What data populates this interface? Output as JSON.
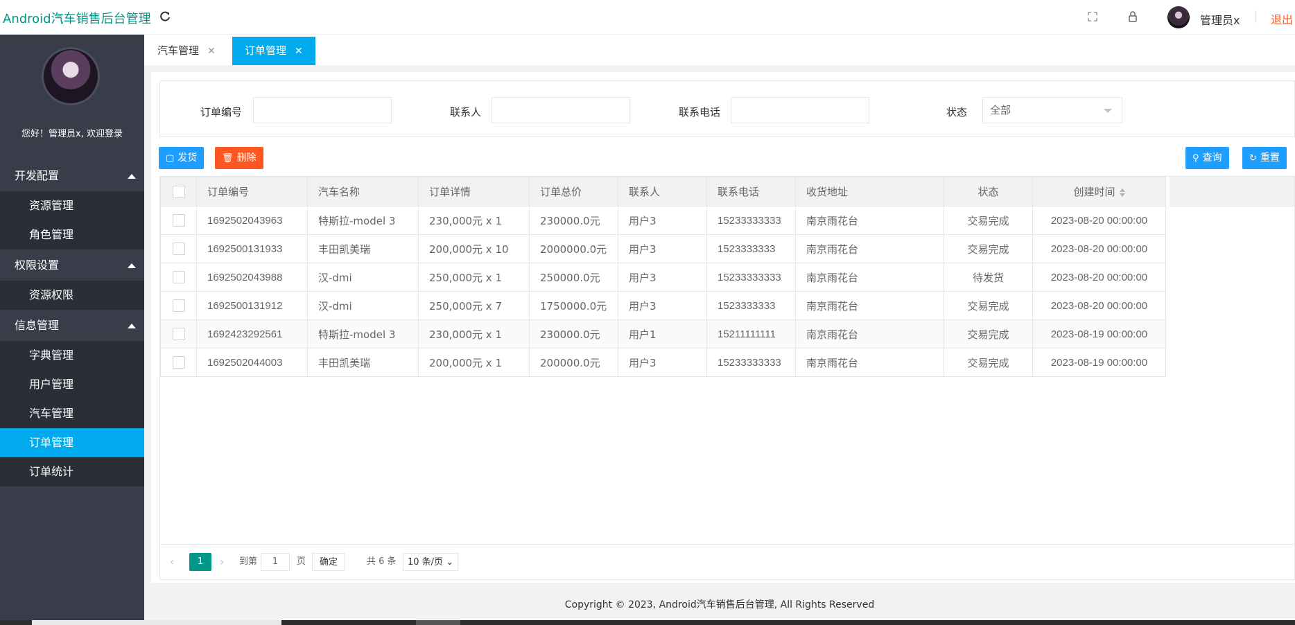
{
  "header": {
    "logo": "Android汽车销售后台管理",
    "user": "管理员x",
    "logout": "退出",
    "icons": [
      "refresh-icon",
      "fullscreen-icon",
      "lock-icon"
    ]
  },
  "sidebar": {
    "welcome": "您好！管理员x, 欢迎登录",
    "groups": [
      {
        "label": "开发配置",
        "items": [
          "资源管理",
          "角色管理"
        ]
      },
      {
        "label": "权限设置",
        "items": [
          "资源权限"
        ]
      },
      {
        "label": "信息管理",
        "items": [
          "字典管理",
          "用户管理",
          "汽车管理",
          "订单管理",
          "订单统计"
        ]
      }
    ],
    "active_item": "订单管理"
  },
  "tabs": [
    {
      "label": "汽车管理",
      "active": false
    },
    {
      "label": "订单管理",
      "active": true
    }
  ],
  "search": {
    "order_no_label": "订单编号",
    "contact_label": "联系人",
    "phone_label": "联系电话",
    "status_label": "状态",
    "order_no_value": "",
    "contact_value": "",
    "phone_value": "",
    "status_value": "全部"
  },
  "toolbar": {
    "ship_label": "发货",
    "delete_label": "删除",
    "query_label": "查询",
    "reset_label": "重置"
  },
  "table": {
    "columns": [
      "订单编号",
      "汽车名称",
      "订单详情",
      "订单总价",
      "联系人",
      "联系电话",
      "收货地址",
      "状态",
      "创建时间"
    ],
    "rows": [
      [
        "1692502043963",
        "特斯拉-model 3",
        "230,000元 x 1",
        "230000.0元",
        "用户3",
        "15233333333",
        "南京雨花台",
        "交易完成",
        "2023-08-20 00:00:00"
      ],
      [
        "1692500131933",
        "丰田凯美瑞",
        "200,000元 x 10",
        "2000000.0元",
        "用户3",
        "1523333333",
        "南京雨花台",
        "交易完成",
        "2023-08-20 00:00:00"
      ],
      [
        "1692502043988",
        "汉-dmi",
        "250,000元 x 1",
        "250000.0元",
        "用户3",
        "15233333333",
        "南京雨花台",
        "待发货",
        "2023-08-20 00:00:00"
      ],
      [
        "1692500131912",
        "汉-dmi",
        "250,000元 x 7",
        "1750000.0元",
        "用户3",
        "1523333333",
        "南京雨花台",
        "交易完成",
        "2023-08-20 00:00:00"
      ],
      [
        "1692423292561",
        "特斯拉-model 3",
        "230,000元 x 1",
        "230000.0元",
        "用户1",
        "15211111111",
        "南京雨花台",
        "交易完成",
        "2023-08-19 00:00:00"
      ],
      [
        "1692502044003",
        "丰田凯美瑞",
        "200,000元 x 1",
        "200000.0元",
        "用户3",
        "15233333333",
        "南京雨花台",
        "交易完成",
        "2023-08-19 00:00:00"
      ]
    ]
  },
  "pager": {
    "current": "1",
    "goto_label": "到第",
    "goto_value": "1",
    "page_unit": "页",
    "confirm": "确定",
    "total": "共 6 条",
    "page_size": "10 条/页"
  },
  "footer": "Copyright © 2023, Android汽车销售后台管理, All Rights Reserved",
  "colors": {
    "brand": "#009688",
    "active_blue": "#01aaed",
    "button_blue": "#1e9fff",
    "danger": "#ff5722",
    "sidebar": "#393d49"
  }
}
